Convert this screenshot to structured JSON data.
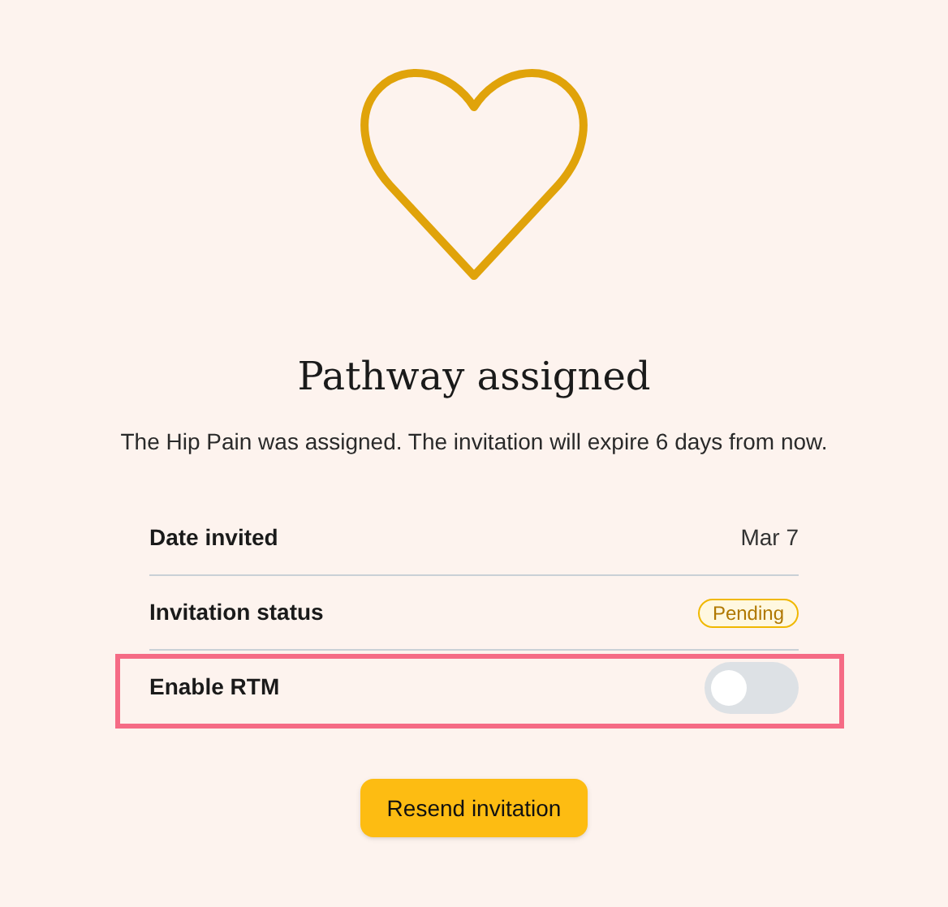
{
  "title": "Pathway assigned",
  "message": "The Hip Pain was assigned. The invitation will expire 6 days from now.",
  "rows": [
    {
      "kind": "text",
      "label": "Date invited",
      "value": "Mar 7",
      "highlighted": false
    },
    {
      "kind": "badge",
      "label": "Invitation status",
      "value": "Pending",
      "highlighted": false
    },
    {
      "kind": "toggle",
      "label": "Enable RTM",
      "on": false,
      "highlighted": true
    }
  ],
  "button": "Resend invitation"
}
